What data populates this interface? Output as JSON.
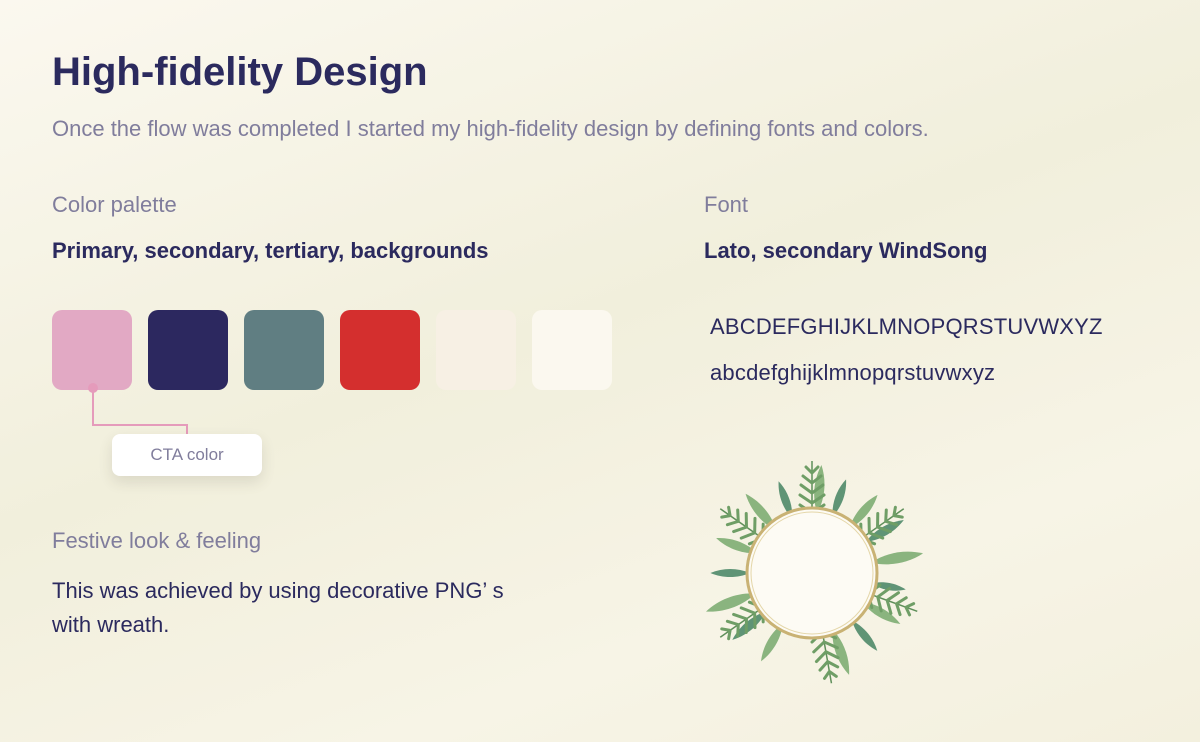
{
  "title": "High-fidelity Design",
  "subtitle": "Once the flow was completed I started my high-fidelity design by defining fonts and colors.",
  "palette": {
    "label": "Color palette",
    "heading": "Primary, secondary, tertiary, backgrounds",
    "swatches": [
      {
        "color": "#e2a9c4"
      },
      {
        "color": "#2c285f"
      },
      {
        "color": "#607e82"
      },
      {
        "color": "#d42f2e"
      },
      {
        "color": "#f7f0e4"
      },
      {
        "color": "#fbf8ef"
      }
    ],
    "callout": "CTA color",
    "callout_line_color": "#e59bbb"
  },
  "font": {
    "label": "Font",
    "heading": "Lato,  secondary WindSong",
    "uppercase": "ABCDEFGHIJKLMNOPQRSTUVWXYZ",
    "lowercase": "abcdefghijklmnopqrstuvwxyz"
  },
  "festive": {
    "label": "Festive look & feeling",
    "body": "This was achieved by using decorative PNG’ s with wreath."
  }
}
